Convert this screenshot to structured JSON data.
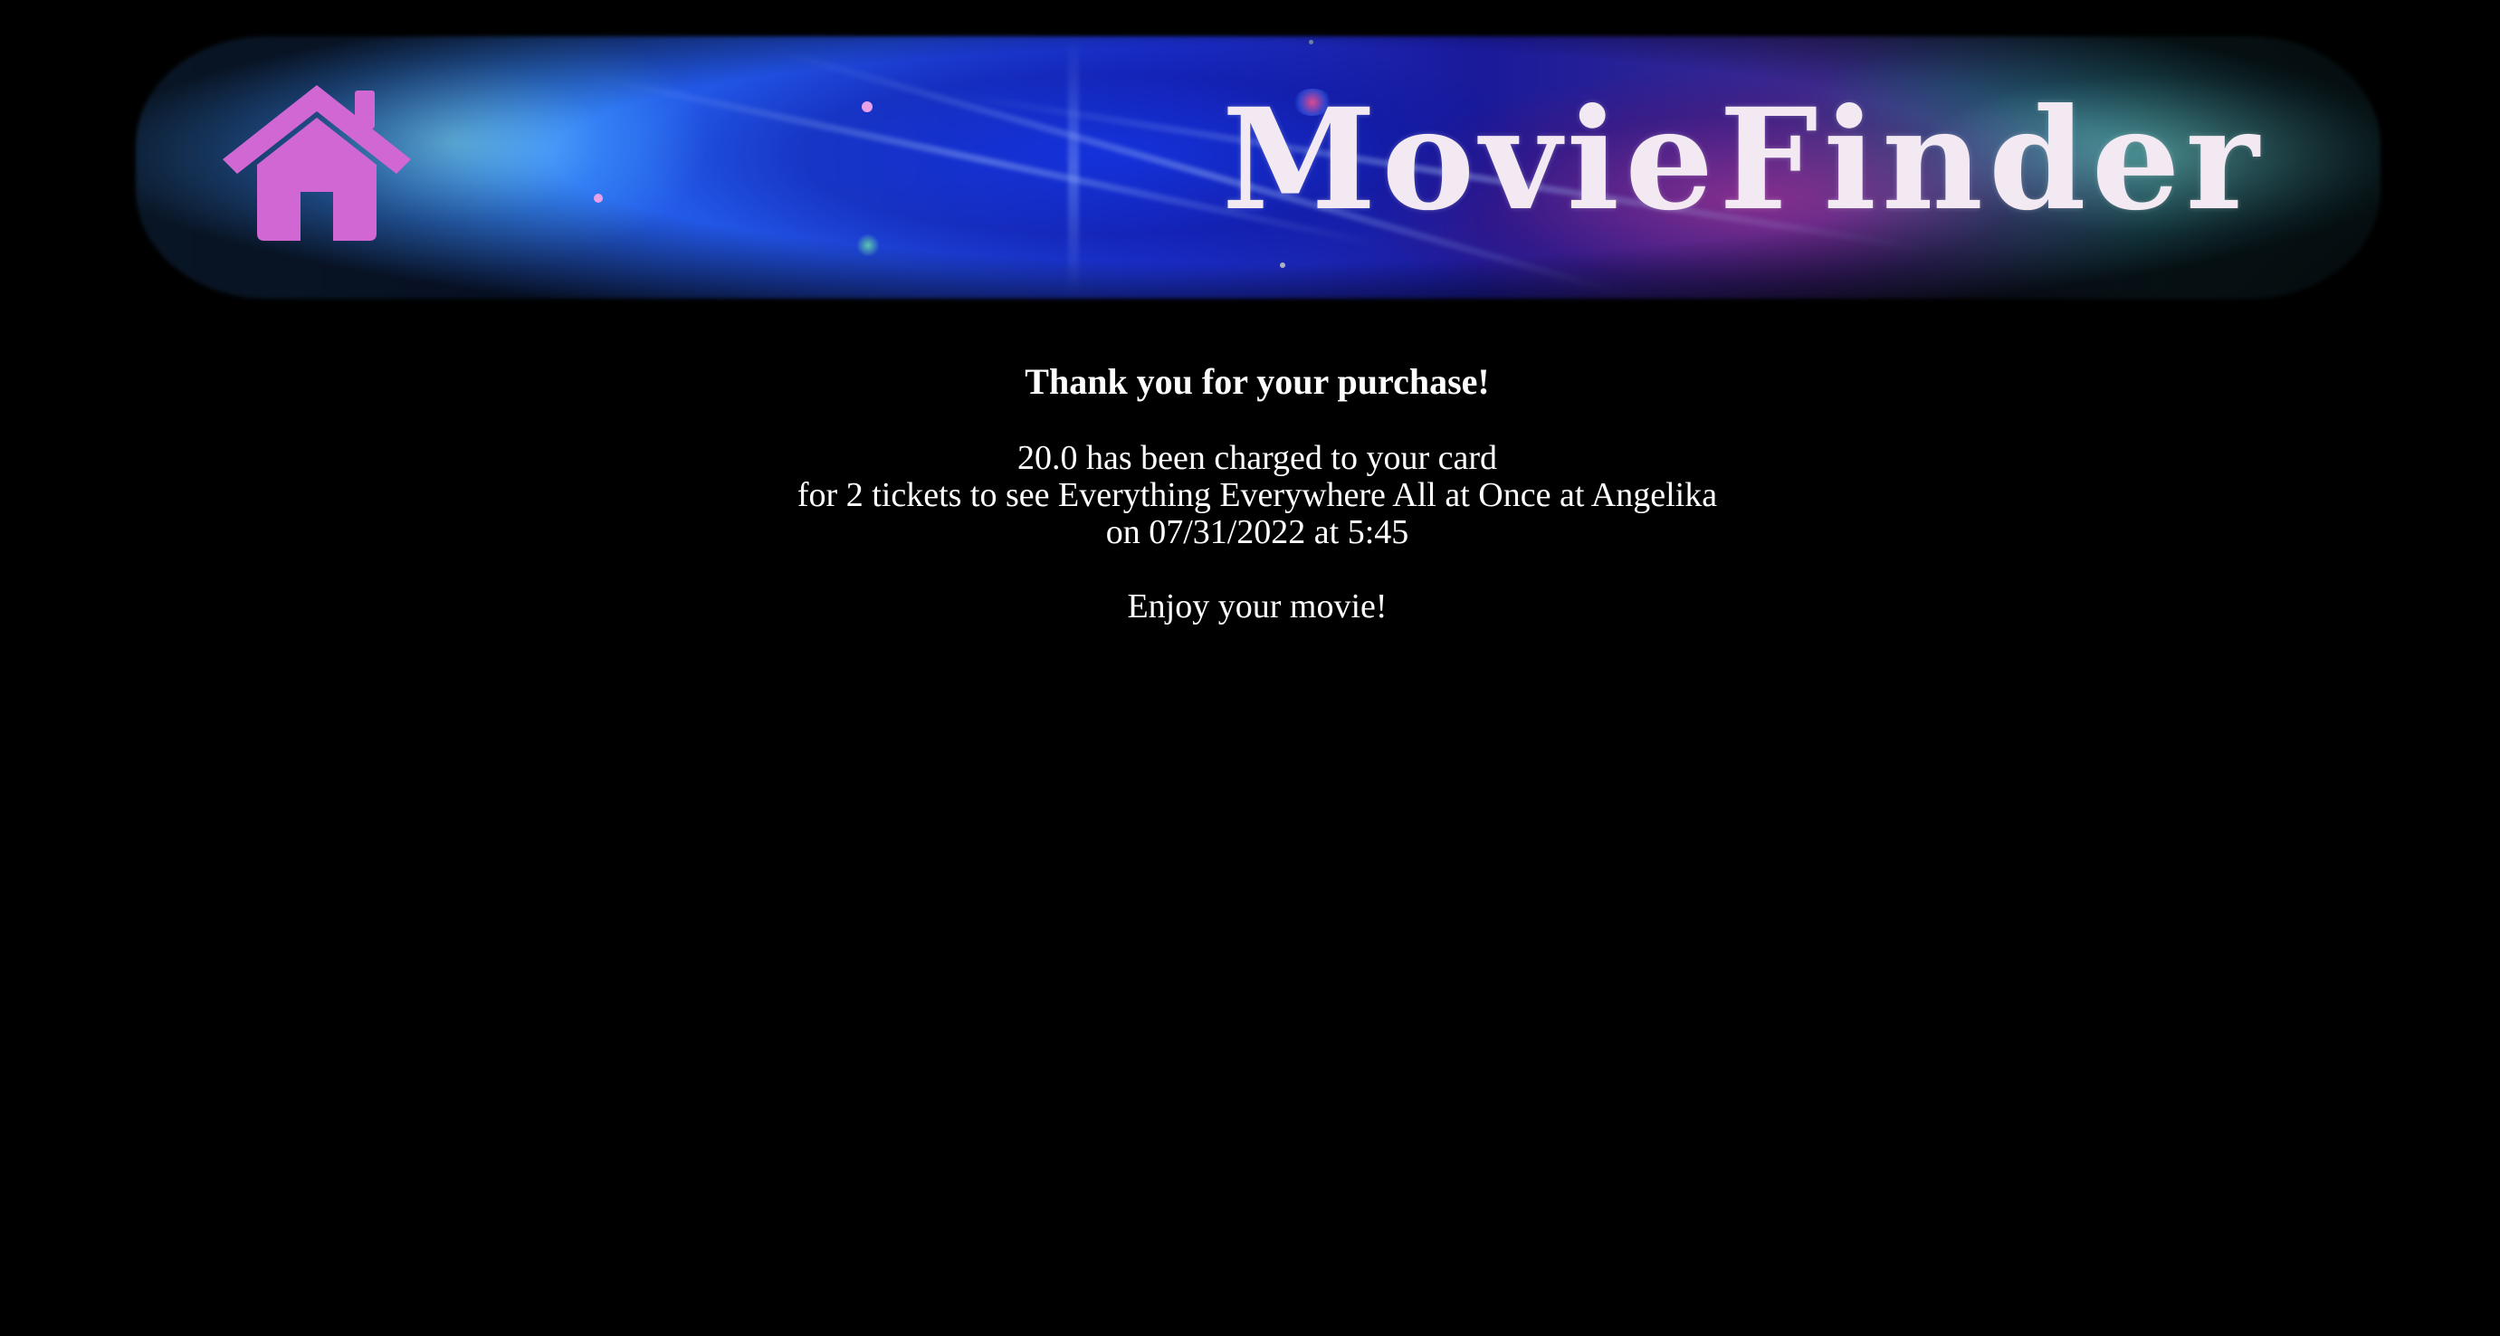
{
  "header": {
    "logo_text": "MovieFinder",
    "home_icon": "home-icon",
    "colors": {
      "home_icon": "#d067d3",
      "logo_text": "#f2e9f2",
      "background": "#000000"
    }
  },
  "confirmation": {
    "heading": "Thank you for your purchase!",
    "charge_line": "20.0 has been charged to your card",
    "tickets_line": "for 2 tickets to see Everything Everywhere All at Once at Angelika",
    "datetime_line": "on 07/31/2022 at 5:45",
    "closing": "Enjoy your movie!"
  }
}
